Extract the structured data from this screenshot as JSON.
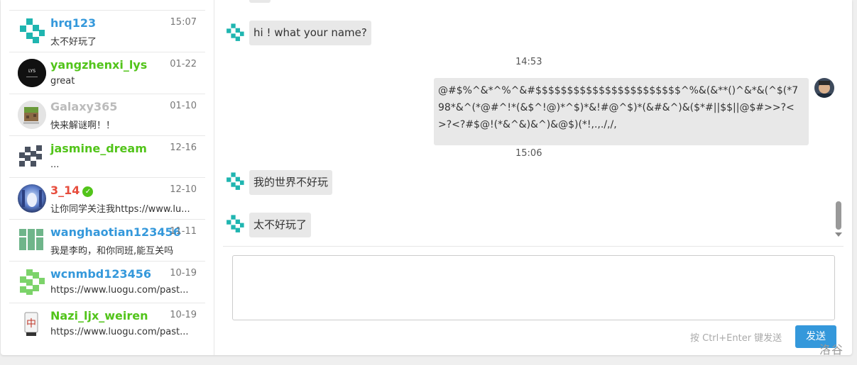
{
  "contacts": [
    {
      "name": "hrq123",
      "time": "15:07",
      "preview": "太不好玩了",
      "name_color": "#3498db",
      "avatar_icon": "luogu-logo-teal"
    },
    {
      "name": "yangzhenxi_lys",
      "time": "01-22",
      "preview": "great",
      "name_color": "#52c41a",
      "avatar_icon": "black-lys-avatar",
      "avatar_text": "LYS"
    },
    {
      "name": "Galaxy365",
      "time": "01-10",
      "preview": "快来解谜啊！！",
      "name_color": "#bbbbbb",
      "avatar_icon": "minecraft-avatar"
    },
    {
      "name": "jasmine_dream",
      "time": "12-16",
      "preview": "...",
      "name_color": "#52c41a",
      "avatar_icon": "pixel-gray-avatar"
    },
    {
      "name": "3_14",
      "time": "12-10",
      "preview": "让你同学关注我https://www.lu...",
      "name_color": "#e74c3c",
      "avatar_icon": "anime-avatar",
      "verified": true
    },
    {
      "name": "wanghaotian123456",
      "time": "11-11",
      "preview": "我是李昀，和你同班,能互关吗",
      "name_color": "#3498db",
      "avatar_icon": "green-t-avatar"
    },
    {
      "name": "wcnmbd123456",
      "time": "10-19",
      "preview": "https://www.luogu.com/past...",
      "name_color": "#3498db",
      "avatar_icon": "pixel-green-avatar"
    },
    {
      "name": "Nazi_ljx_weiren",
      "time": "10-19",
      "preview": "https://www.luogu.com/past...",
      "name_color": "#52c41a",
      "avatar_icon": "mahjong-avatar",
      "avatar_text": "中"
    }
  ],
  "messages": {
    "m1": "hi ! what your name?",
    "t1": "14:53",
    "m2": "@#$%^&*^%^&#$$$$$$$$$$$$$$$$$$$$$$$^%&(&**()^&*&(^$(*798*&^(*@#^!*(&$^!@)*^$)*&!#@^$)*(&#&^)&($*#||$$||@$#>>?<>?<?#$@!(*&^&)&^)&@$)(*!,.,./,/,",
    "t2": "15:06",
    "m3": "我的世界不好玩",
    "m4": "太不好玩了"
  },
  "composer": {
    "hint": "按 Ctrl+Enter 键发送",
    "send_label": "发送"
  },
  "watermark": "洛谷",
  "colors": {
    "accent": "#3498db",
    "bubble": "#e8e8e8",
    "teal": "#1fb5b0"
  }
}
